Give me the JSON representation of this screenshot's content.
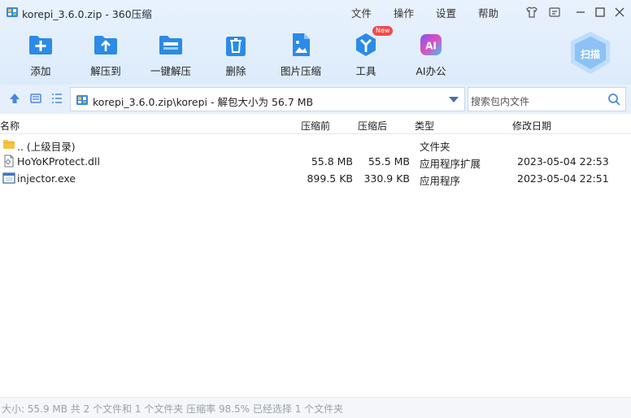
{
  "window": {
    "title": "korepi_3.6.0.zip - 360压缩",
    "menu": [
      "文件",
      "操作",
      "设置",
      "帮助"
    ]
  },
  "toolbar": {
    "buttons": [
      {
        "label": "添加",
        "icon": "add-icon"
      },
      {
        "label": "解压到",
        "icon": "extract-to-icon"
      },
      {
        "label": "一键解压",
        "icon": "one-click-extract-icon"
      },
      {
        "label": "删除",
        "icon": "delete-icon"
      },
      {
        "label": "图片压缩",
        "icon": "image-compress-icon"
      },
      {
        "label": "工具",
        "icon": "tools-icon",
        "badge": "New"
      },
      {
        "label": "AI办公",
        "icon": "ai-office-icon"
      }
    ],
    "scan_label": "扫描"
  },
  "address": {
    "path": "korepi_3.6.0.zip\\korepi - 解包大小为 56.7 MB",
    "search_placeholder": "搜索包内文件"
  },
  "columns": {
    "name": "名称",
    "packed": "压缩前",
    "compressed": "压缩后",
    "type": "类型",
    "modified": "修改日期"
  },
  "files": [
    {
      "name": ".. (上级目录)",
      "size": "",
      "packed": "",
      "type": "文件夹",
      "modified": "",
      "icon": "folder-icon"
    },
    {
      "name": "HoYoKProtect.dll",
      "size": "55.8 MB",
      "packed": "55.5 MB",
      "type": "应用程序扩展",
      "modified": "2023-05-04 22:53",
      "icon": "dll-file-icon"
    },
    {
      "name": "injector.exe",
      "size": "899.5 KB",
      "packed": "330.9 KB",
      "type": "应用程序",
      "modified": "2023-05-04 22:51",
      "icon": "exe-file-icon"
    }
  ],
  "status": "大小: 55.9 MB 共 2 个文件和 1 个文件夹 压缩率 98.5% 已经选择 1 个文件夹",
  "colors": {
    "header_bg": "#e9f2fd",
    "accent_blue": "#2b8be6",
    "new_badge": "#f24a4a"
  }
}
